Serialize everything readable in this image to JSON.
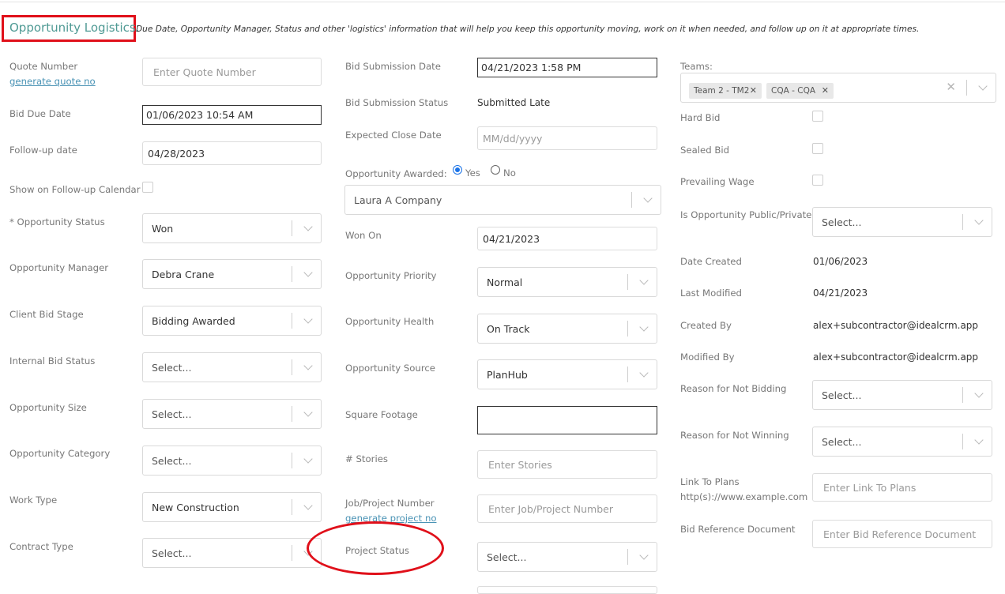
{
  "header": {
    "title": "Opportunity Logistics:",
    "description": "Due Date, Opportunity Manager, Status and other 'logistics' information that will help you keep this opportunity moving, work on it when needed, and follow up on it at appropriate times."
  },
  "col1": {
    "quote_number_label": "Quote Number",
    "generate_quote_link": "generate quote no",
    "quote_number_placeholder": "Enter Quote Number",
    "bid_due_date_label": "Bid Due Date",
    "bid_due_date_value": "01/06/2023 10:54 AM",
    "followup_date_label": "Follow-up date",
    "followup_date_value": "04/28/2023",
    "show_calendar_label": "Show on Follow-up Calendar",
    "status_label": "* Opportunity Status",
    "status_value": "Won",
    "manager_label": "Opportunity Manager",
    "manager_value": "Debra Crane",
    "client_bid_stage_label": "Client Bid Stage",
    "client_bid_stage_value": "Bidding Awarded",
    "internal_bid_status_label": "Internal Bid Status",
    "internal_bid_status_value": "Select...",
    "size_label": "Opportunity Size",
    "size_value": "Select...",
    "category_label": "Opportunity Category",
    "category_value": "Select...",
    "work_type_label": "Work Type",
    "work_type_value": "New Construction",
    "contract_type_label": "Contract Type",
    "contract_type_value": "Select..."
  },
  "col2": {
    "bid_submission_date_label": "Bid Submission Date",
    "bid_submission_date_value": "04/21/2023 1:58 PM",
    "bid_submission_status_label": "Bid Submission Status",
    "bid_submission_status_value": "Submitted Late",
    "expected_close_label": "Expected Close Date",
    "expected_close_placeholder": "MM/dd/yyyy",
    "awarded_label": "Opportunity Awarded:",
    "awarded_yes": "Yes",
    "awarded_no": "No",
    "awarded_company": "Laura A Company",
    "won_on_label": "Won On",
    "won_on_value": "04/21/2023",
    "priority_label": "Opportunity Priority",
    "priority_value": "Normal",
    "health_label": "Opportunity Health",
    "health_value": "On Track",
    "source_label": "Opportunity Source",
    "source_value": "PlanHub",
    "sqft_label": "Square Footage",
    "sqft_value": "",
    "stories_label": "# Stories",
    "stories_placeholder": "Enter Stories",
    "job_number_label": "Job/Project Number",
    "generate_project_link": "generate project no",
    "job_number_placeholder": "Enter Job/Project Number",
    "project_status_label": "Project Status",
    "project_status_value": "Select..."
  },
  "col3": {
    "teams_label": "Teams:",
    "teams": [
      "Team 2 - TM2",
      "CQA - CQA"
    ],
    "hard_bid_label": "Hard Bid",
    "sealed_bid_label": "Sealed Bid",
    "prevailing_wage_label": "Prevailing Wage",
    "public_private_label": "Is Opportunity Public/Private",
    "public_private_value": "Select...",
    "date_created_label": "Date Created",
    "date_created_value": "01/06/2023",
    "last_modified_label": "Last Modified",
    "last_modified_value": "04/21/2023",
    "created_by_label": "Created By",
    "created_by_value": "alex+subcontractor@idealcrm.app",
    "modified_by_label": "Modified By",
    "modified_by_value": "alex+subcontractor@idealcrm.app",
    "not_bidding_label": "Reason for Not Bidding",
    "not_bidding_value": "Select...",
    "not_winning_label": "Reason for Not Winning",
    "not_winning_value": "Select...",
    "link_plans_label": "Link To Plans",
    "link_plans_hint": "http(s)://www.example.com",
    "link_plans_placeholder": "Enter Link To Plans",
    "bid_ref_label": "Bid Reference Document",
    "bid_ref_placeholder": "Enter Bid Reference Document"
  },
  "colors": {
    "title_teal": "#4f9a94",
    "annotation_red": "#e0101a",
    "link_blue": "#4a93b5"
  }
}
